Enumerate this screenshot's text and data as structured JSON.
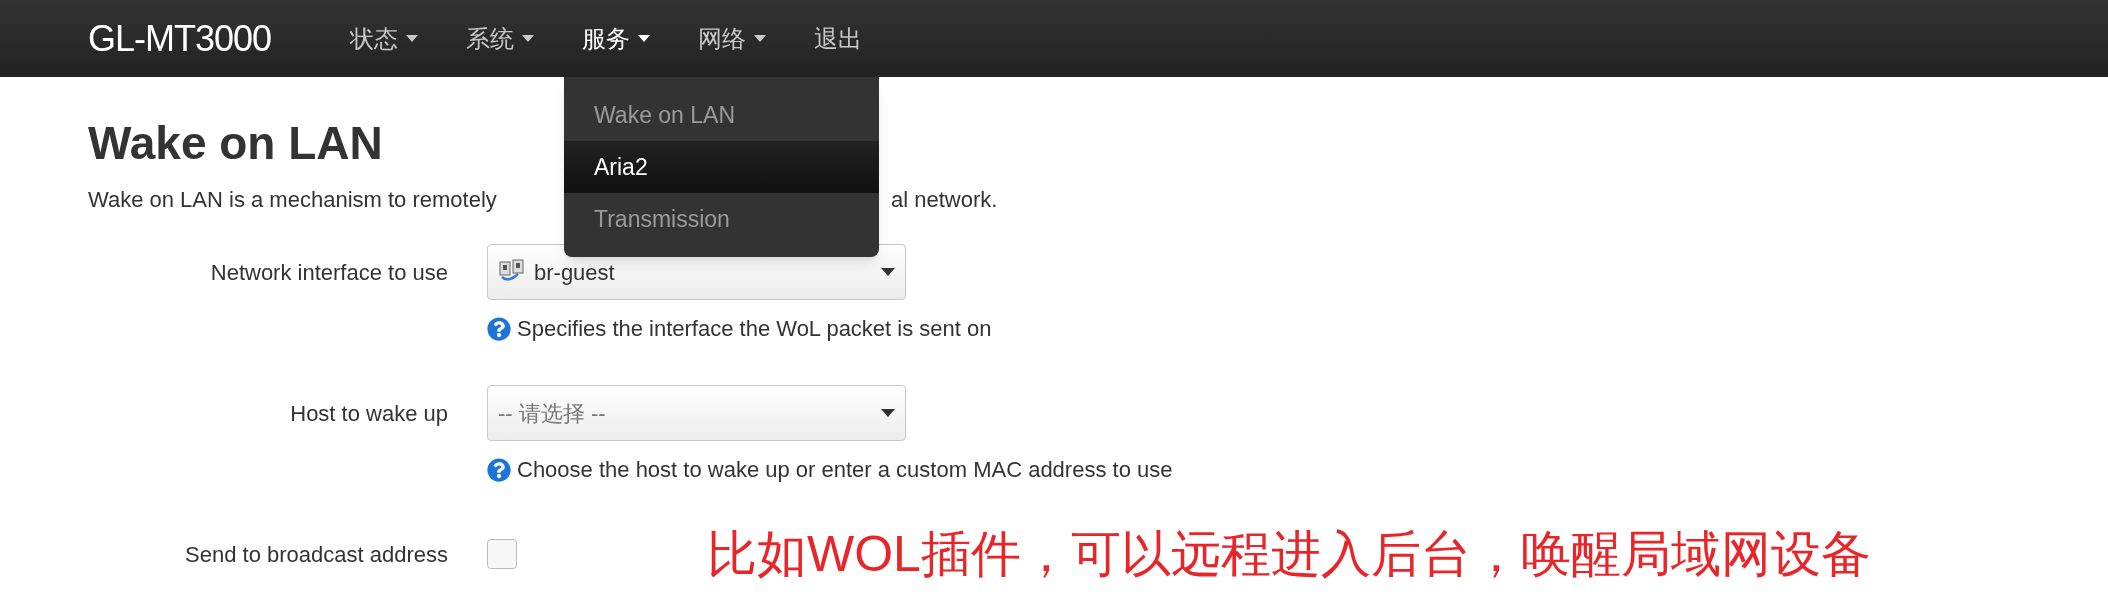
{
  "navbar": {
    "brand": "GL-MT3000",
    "menus": [
      {
        "label": "状态",
        "kind": "dropdown",
        "expanded": false
      },
      {
        "label": "系统",
        "kind": "dropdown",
        "expanded": false
      },
      {
        "label": "服务",
        "kind": "dropdown",
        "expanded": true,
        "items": [
          {
            "label": "Wake on LAN",
            "selected": false
          },
          {
            "label": "Aria2",
            "selected": true
          },
          {
            "label": "Transmission",
            "selected": false
          }
        ]
      },
      {
        "label": "网络",
        "kind": "dropdown",
        "expanded": false
      },
      {
        "label": "退出",
        "kind": "link",
        "expanded": false
      }
    ]
  },
  "page": {
    "title": "Wake on LAN",
    "description_start": "Wake on LAN is a mechanism to remotely",
    "description_end": "al network.",
    "fields": [
      {
        "kind": "select",
        "label": "Network interface to use",
        "value": "br-guest",
        "help": "Specifies the interface the WoL packet is sent on"
      },
      {
        "kind": "select",
        "label": "Host to wake up",
        "placeholder": "-- 请选择 --",
        "help": "Choose the host to wake up or enter a custom MAC address to use"
      },
      {
        "kind": "checkbox",
        "label": "Send to broadcast address",
        "checked": false
      }
    ]
  },
  "annotation": {
    "text": "比如WOL插件，可以远程进入后台，唤醒局域网设备",
    "color": "#e8262a"
  }
}
